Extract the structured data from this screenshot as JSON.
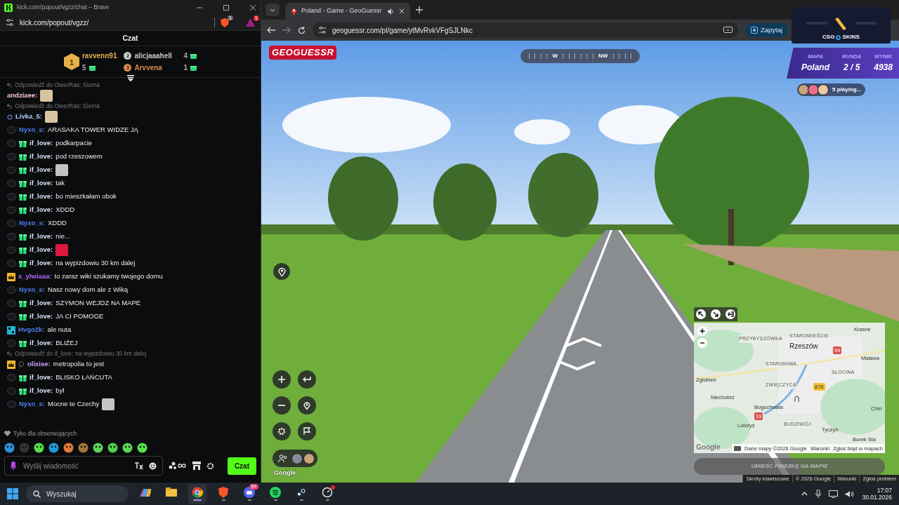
{
  "chat_window": {
    "title": "kick.com/popout/vgzz/chat – Brave",
    "url": "kick.com/popout/vgzz/",
    "shield_badge": "1",
    "rewards_badge": "1",
    "header": "Czat",
    "leaderboard": [
      {
        "rank": "1",
        "name": "ravvenn91",
        "count": "5",
        "color": "#e6b04c"
      },
      {
        "rank": "2",
        "name": "alicjaaahell",
        "count": "4",
        "color": "#c9c9c9"
      },
      {
        "rank": "3",
        "name": "Arvvena",
        "count": "1",
        "color": "#d98a4e"
      }
    ],
    "messages": [
      {
        "reply_to": "Odpowiedź do OwerRas: Siema",
        "user": "andziaee:",
        "color": "#f2c4d6",
        "emote": true
      },
      {
        "reply_to": "Odpowiedź do OwerRas: Siema",
        "badges": [
          {
            "kind": "dot"
          }
        ],
        "user": "Livka_5:",
        "color": "#b4ccff",
        "emote": true
      },
      {
        "badges": [
          {
            "kind": "ring"
          }
        ],
        "user": "Nyxo_s:",
        "color": "#4f7ff5",
        "text": "ARASAKA TOWER WIDZE JĄ",
        "emote": false
      },
      {
        "badges": [
          {
            "kind": "ring"
          },
          {
            "kind": "gift"
          }
        ],
        "user": "if_love:",
        "color": "#dbe6ff",
        "text": "podkarpacie",
        "emote": false
      },
      {
        "badges": [
          {
            "kind": "ring"
          },
          {
            "kind": "gift"
          }
        ],
        "user": "if_love:",
        "color": "#dbe6ff",
        "text": "pod rzeszowem",
        "emote": false
      },
      {
        "badges": [
          {
            "kind": "ring"
          },
          {
            "kind": "gift"
          }
        ],
        "user": "if_love:",
        "color": "#dbe6ff",
        "emote": true
      },
      {
        "badges": [
          {
            "kind": "ring"
          },
          {
            "kind": "gift"
          }
        ],
        "user": "if_love:",
        "color": "#dbe6ff",
        "text": "tak",
        "emote": false
      },
      {
        "badges": [
          {
            "kind": "ring"
          },
          {
            "kind": "gift"
          }
        ],
        "user": "if_love:",
        "color": "#dbe6ff",
        "text": "bo mieszkałam obok",
        "emote": false
      },
      {
        "badges": [
          {
            "kind": "ring"
          },
          {
            "kind": "gift"
          }
        ],
        "user": "if_love:",
        "color": "#dbe6ff",
        "text": "XDDD",
        "emote": false
      },
      {
        "badges": [
          {
            "kind": "ring"
          }
        ],
        "user": "Nyxo_s:",
        "color": "#4f7ff5",
        "text": "XDDD",
        "emote": false
      },
      {
        "badges": [
          {
            "kind": "ring"
          },
          {
            "kind": "gift"
          }
        ],
        "user": "if_love:",
        "color": "#dbe6ff",
        "text": "nie...",
        "emote": false
      },
      {
        "badges": [
          {
            "kind": "ring"
          },
          {
            "kind": "gift"
          }
        ],
        "user": "if_love:",
        "color": "#dbe6ff",
        "emote": true
      },
      {
        "badges": [
          {
            "kind": "ring"
          },
          {
            "kind": "gift"
          }
        ],
        "user": "if_love:",
        "color": "#dbe6ff",
        "text": "na wypizdowiu 30 km dalej",
        "emote": false
      },
      {
        "badges": [
          {
            "kind": "crown"
          }
        ],
        "user": "s_ylwiaaa:",
        "color": "#b266ff",
        "text": "to zaraz wiki szukamy twojego domu",
        "emote": false
      },
      {
        "badges": [
          {
            "kind": "ring"
          }
        ],
        "user": "Nyxo_s:",
        "color": "#4f7ff5",
        "text": "Nasz nowy dom ale z Wiką",
        "emote": false
      },
      {
        "badges": [
          {
            "kind": "ring"
          },
          {
            "kind": "gift"
          }
        ],
        "user": "if_love:",
        "color": "#dbe6ff",
        "text": "SZYMON WEJDZ NA MAPE",
        "emote": false
      },
      {
        "badges": [
          {
            "kind": "ring"
          },
          {
            "kind": "gift"
          }
        ],
        "user": "if_love:",
        "color": "#dbe6ff",
        "text": "JA CI POMOGE",
        "emote": false
      },
      {
        "badges": [
          {
            "kind": "pixel"
          }
        ],
        "user": "Hvgo2k:",
        "color": "#4f7ff5",
        "text": "ale nuta",
        "emote": false
      },
      {
        "badges": [
          {
            "kind": "ring"
          },
          {
            "kind": "gift"
          }
        ],
        "user": "if_love:",
        "color": "#dbe6ff",
        "text": "BLIŻEJ",
        "emote": false
      },
      {
        "reply_to": "Odpowiedź do if_love: na wypizdowiu 30 km dalej",
        "badges": [
          {
            "kind": "crown"
          },
          {
            "kind": "bubble"
          }
        ],
        "user": "olixise:",
        "color": "#c9a0ff",
        "text": "metropolia to jest",
        "emote": false
      },
      {
        "badges": [
          {
            "kind": "ring"
          },
          {
            "kind": "gift"
          }
        ],
        "user": "if_love:",
        "color": "#dbe6ff",
        "text": "BLISKO ŁAŃCUTA",
        "emote": false
      },
      {
        "badges": [
          {
            "kind": "ring"
          },
          {
            "kind": "gift"
          }
        ],
        "user": "if_love:",
        "color": "#dbe6ff",
        "text": "był",
        "emote": false
      },
      {
        "badges": [
          {
            "kind": "ring"
          }
        ],
        "user": "Nyxo_s:",
        "color": "#4f7ff5",
        "text": "Mocne te Czechy",
        "emote": true
      }
    ],
    "followers_only": "Tyko dla obserwujących",
    "input": {
      "placeholder": "Wyślij wiadomość"
    },
    "send_button": "Czat"
  },
  "browser": {
    "tab": {
      "title": "Poland - Game - GeoGuessr",
      "selected": true
    },
    "url": "geoguessr.com/pl/game/ytMvRvkVFgSJLNkc",
    "ask_button": "Zapytaj",
    "ad": {
      "left": "CSG",
      "right": "SKINS"
    },
    "game": {
      "logo": "GEOGUESSR",
      "compass": [
        "W",
        "NW"
      ],
      "hud": [
        {
          "label": "MAPA",
          "value": "Poland"
        },
        {
          "label": "RUNDA",
          "value": "2 / 5"
        },
        {
          "label": "WYNIK",
          "value": "4938"
        }
      ],
      "players": "5 playing...",
      "map_labels": [
        {
          "text": "Krasne",
          "kind": "town"
        },
        {
          "text": "STAROMIEŚCIE",
          "kind": "district"
        },
        {
          "text": "PRZYBYSZÓWKA",
          "kind": "district"
        },
        {
          "text": "Rzeszów",
          "kind": "city"
        },
        {
          "text": "94",
          "kind": "road"
        },
        {
          "text": "Malawa",
          "kind": "town"
        },
        {
          "text": "STARONIWA",
          "kind": "district"
        },
        {
          "text": "SŁOCINA",
          "kind": "district"
        },
        {
          "text": "Zgłobień",
          "kind": "town"
        },
        {
          "text": "ZWIĘCZYCA",
          "kind": "district"
        },
        {
          "text": "878",
          "kind": "road"
        },
        {
          "text": "Niechobrz",
          "kind": "town"
        },
        {
          "text": "Boguchwała",
          "kind": "town"
        },
        {
          "text": "Chm",
          "kind": "town"
        },
        {
          "text": "19",
          "kind": "road"
        },
        {
          "text": "Lutoryż",
          "kind": "town"
        },
        {
          "text": "BUDZIWÓJ",
          "kind": "district"
        },
        {
          "text": "Tyczyn",
          "kind": "town"
        },
        {
          "text": "Borek Sta",
          "kind": "town"
        }
      ],
      "map_logo": "Google",
      "map_footer": [
        "Dane mapy ©2026 Google",
        "Warunki",
        "Zgłoś błąd w mapach"
      ],
      "place_button": {
        "label": "UMIEŚĆ PINEZKĘ NA MAPIE",
        "disabled": true
      },
      "street_logo": "Google",
      "footer": [
        "Skróty klawiszowe",
        "© 2026 Google",
        "Warunki",
        "Zgłoś problem"
      ]
    }
  },
  "taskbar": {
    "search": "Wyszukaj",
    "apps": [
      {
        "running": false,
        "selected": false,
        "notification": false
      },
      {
        "running": false,
        "selected": false,
        "notification": false
      },
      {
        "running": true,
        "selected": true,
        "notification": false
      },
      {
        "running": true,
        "selected": false,
        "notification": false
      },
      {
        "running": true,
        "selected": false,
        "notification": false,
        "badge": "9+"
      },
      {
        "running": true,
        "selected": false,
        "notification": false
      },
      {
        "running": true,
        "selected": false,
        "notification": false
      },
      {
        "running": true,
        "selected": false,
        "notification": true
      }
    ],
    "time": "17:07",
    "date": "30.01.2026"
  }
}
